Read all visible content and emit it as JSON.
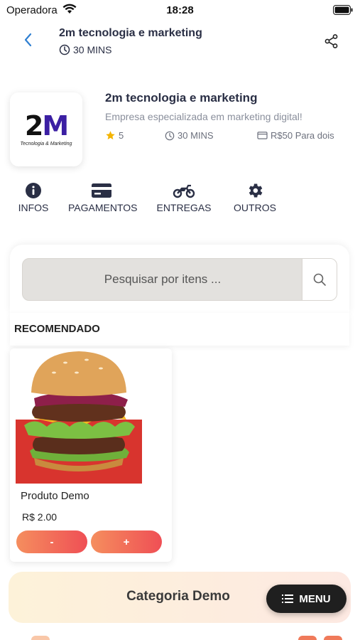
{
  "status": {
    "carrier": "Operadora",
    "time": "18:28"
  },
  "header": {
    "title": "2m tecnologia e marketing",
    "delivery_time": "30 MINS"
  },
  "store": {
    "logo_caption": "Tecnologia & Marketing",
    "logo_text_a": "2",
    "logo_text_b": "M",
    "name": "2m tecnologia e marketing",
    "description": "Empresa especializada em marketing digital!",
    "rating": "5",
    "time": "30 MINS",
    "price": "R$50 Para dois"
  },
  "info_tabs": [
    {
      "label": "INFOS",
      "icon": "info-icon"
    },
    {
      "label": "PAGAMENTOS",
      "icon": "credit-card-icon"
    },
    {
      "label": "ENTREGAS",
      "icon": "motorcycle-icon"
    },
    {
      "label": "OUTROS",
      "icon": "gear-icon"
    }
  ],
  "search": {
    "placeholder": "Pesquisar por itens ..."
  },
  "recommended": {
    "title": "RECOMENDADO",
    "product": {
      "name": "Produto Demo",
      "price": "R$ 2.00",
      "minus_label": "-",
      "plus_label": "+"
    }
  },
  "category": {
    "title": "Categoria Demo"
  },
  "menu_button": {
    "label": "MENU"
  },
  "colors": {
    "accent_start": "#f58e5e",
    "accent_end": "#ef4f55",
    "back_arrow": "#2f7fd1",
    "star": "#f4b400"
  }
}
